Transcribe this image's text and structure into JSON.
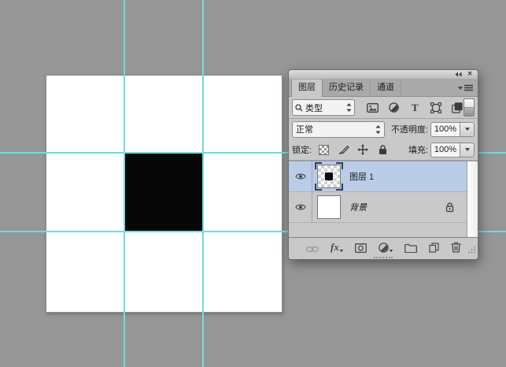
{
  "desktop": {
    "background_color": "#969696"
  },
  "canvas": {
    "guides": {
      "color": "#74dada"
    },
    "document_color": "#ffffff",
    "square_color": "#070707"
  },
  "panel": {
    "selected_row_color": "#b9cde9",
    "titlebar": {
      "close_glyph": "×"
    },
    "tabs": [
      {
        "label": "图层"
      },
      {
        "label": "历史记录"
      },
      {
        "label": "通道"
      }
    ],
    "filter_row": {
      "search_label": "类型",
      "type_icon_glyph": "T"
    },
    "blend_row": {
      "mode": "正常",
      "opacity_label": "不透明度:",
      "opacity_value": "100%"
    },
    "lock_row": {
      "label": "锁定:",
      "fill_label": "填充:",
      "fill_value": "100%"
    },
    "layers": [
      {
        "name": "图层 1"
      },
      {
        "name": "背景"
      }
    ],
    "bottom_bar": {
      "fx_label": "fx"
    }
  }
}
